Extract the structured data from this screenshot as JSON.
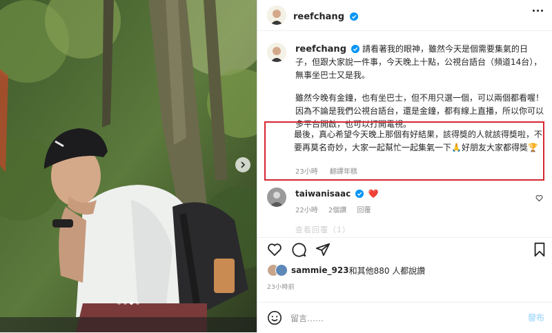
{
  "post": {
    "author": "reefchang",
    "image_count": 4,
    "active_image": 3
  },
  "caption": {
    "username": "reefchang",
    "paragraph1": "請看著我的眼神，雖然今天是個需要集氣的日子，但跟大家說一件事，今天晚上十點，公視台語台（頻道14台），無事坐巴士又是我。",
    "paragraph2": "雖然今晚有金鐘，也有坐巴士，但不用只選一個，可以兩個都看喔！因為不論是我們公視台語台，還是金鐘，都有線上直播，所以你可以多平台開啟，也可以打開電視。",
    "paragraph3": "最後，真心希望今天晚上那個有好結果，該得獎的人就該得獎啦，不要再莫名奇妙，大家一起幫忙一起集氣一下🙏好朋友大家都得獎🏆",
    "time": "23小時",
    "translate": "翻譯年糕"
  },
  "comment": {
    "username": "taiwanisaac",
    "emoji": "❤️",
    "time": "22小時",
    "likes": "2個讚",
    "reply": "回覆",
    "faded_text": "查看回覆（1）"
  },
  "likes": {
    "text_user": "sammie_923",
    "text_rest": "和其他880 人都說讚"
  },
  "timestamp": "23小時前",
  "add_comment": {
    "placeholder": "留言……",
    "post_label": "發布"
  },
  "colors": {
    "verified": "#0095f6",
    "highlight_border": "#d7262f",
    "heart": "#ed4956",
    "post_button": "#b2dffc"
  }
}
